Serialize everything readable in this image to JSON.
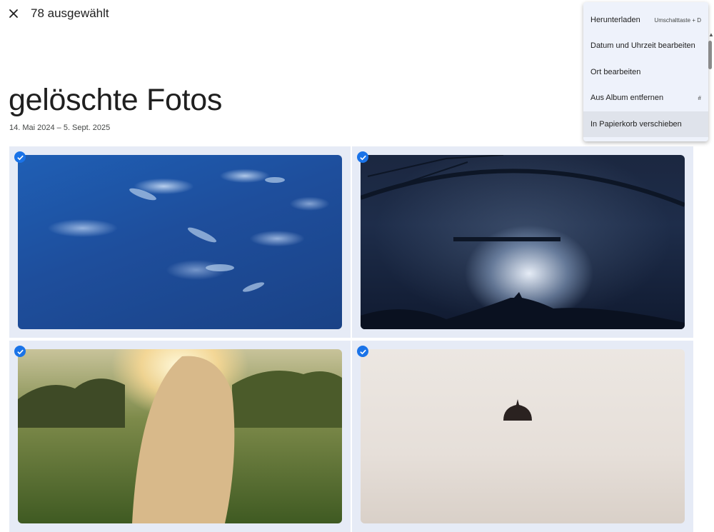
{
  "header": {
    "close_icon": "close-icon",
    "selection_label": "78 ausgewählt"
  },
  "album": {
    "title": "gelöschte Fotos",
    "date_range": "14. Mai 2024 – 5. Sept. 2025"
  },
  "photos": [
    {
      "name": "underwater-fish",
      "selected": true
    },
    {
      "name": "concert-stage",
      "selected": true
    },
    {
      "name": "sunset-hair",
      "selected": true
    },
    {
      "name": "temple-dome",
      "selected": true
    }
  ],
  "menu": {
    "items": [
      {
        "label": "Herunterladen",
        "shortcut": "Umschalttaste + D"
      },
      {
        "label": "Datum und Uhrzeit bearbeiten",
        "shortcut": ""
      },
      {
        "label": "Ort bearbeiten",
        "shortcut": ""
      },
      {
        "label": "Aus Album entfernen",
        "shortcut": "#"
      },
      {
        "label": "In Papierkorb verschieben",
        "shortcut": ""
      }
    ]
  },
  "colors": {
    "accent": "#1a73e8",
    "cell_bg": "#e6ebf6",
    "menu_bg": "#eef2fb",
    "menu_hover": "#dfe3eb"
  }
}
